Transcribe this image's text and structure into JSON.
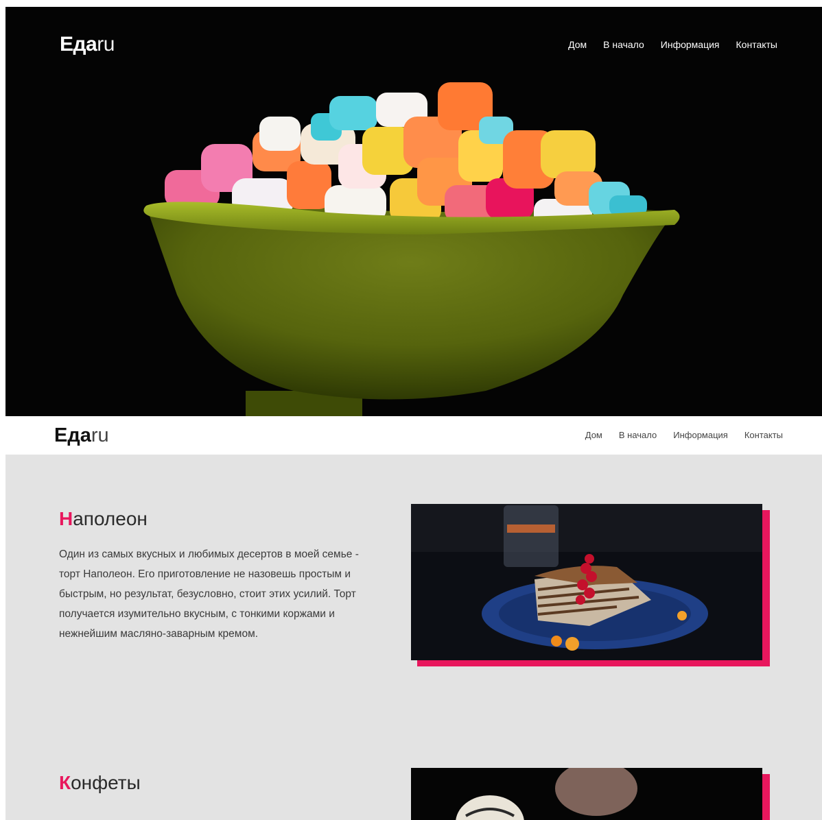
{
  "brand": {
    "bold": "Еда",
    "light": "ru"
  },
  "nav": [
    "Дом",
    "В начало",
    "Информация",
    "Контакты"
  ],
  "sections": [
    {
      "title_first": "Н",
      "title_rest": "аполеон",
      "text": "Один из самых вкусных и любимых десертов в моей семье - торт Наполеон. Его приготовление не назовешь простым и быстрым, но результат, безусловно, стоит этих усилий. Торт получается изумительно вкусным, с тонкими коржами и нежнейшим масляно-заварным кремом."
    },
    {
      "title_first": "К",
      "title_rest": "онфеты"
    }
  ],
  "colors": {
    "accent": "#e8175d",
    "hero_bg": "#040404",
    "content_bg": "#e3e3e3"
  },
  "icons": {
    "hero_image": "candy-bowl-photo",
    "napoleon_image": "napoleon-cake-photo",
    "candies_image": "candies-photo"
  }
}
